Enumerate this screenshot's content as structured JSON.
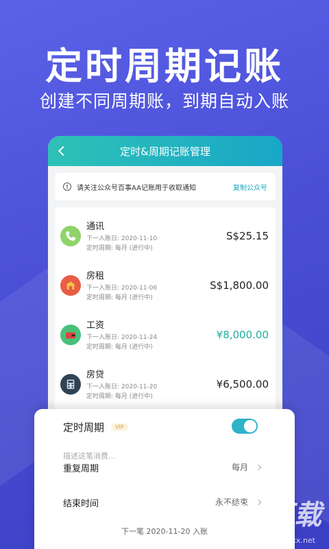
{
  "promo": {
    "headline": "定时周期记账",
    "subline": "创建不同周期账，到期自动入账"
  },
  "app": {
    "title": "定时&周期记账管理",
    "notice_text": "请关注公众号百事AA记账用于收取通知",
    "copy_label": "复制公众号"
  },
  "records": [
    {
      "name": "通讯",
      "next_date": "下一入账日: 2020-11-10",
      "cycle": "定时周期: 每月 (进行中)",
      "amount": "S$25.15",
      "icon": "phone-icon",
      "color": "#8fd36a"
    },
    {
      "name": "房租",
      "next_date": "下一入账日: 2020-11-06",
      "cycle": "定时周期: 每月 (进行中)",
      "amount": "S$1,800.00",
      "icon": "house-icon",
      "color": "#e95c45"
    },
    {
      "name": "工资",
      "next_date": "下一入账日: 2020-11-24",
      "cycle": "定时周期: 每月 (进行中)",
      "amount": "¥8,000.00",
      "icon": "wallet-icon",
      "color": "#49c07a",
      "income": true
    },
    {
      "name": "房贷",
      "next_date": "下一入账日: 2020-11-20",
      "cycle": "定时周期: 每月 (进行中)",
      "amount": "¥6,500.00",
      "icon": "calculator-icon",
      "color": "#2f4354"
    }
  ],
  "sheet": {
    "toggle_label": "定时周期",
    "vip_badge": "VIP",
    "description_placeholder": "描述这笔消费...",
    "repeat_label": "重复周期",
    "repeat_value": "每月",
    "end_label": "结束时间",
    "end_value": "永不结束",
    "next_entry": "下一笔 2020-11-20 入账"
  },
  "watermark": {
    "logo": "KK下载",
    "url": "www.kkx.net"
  },
  "colors": {
    "background": "#4a4fd6",
    "accent": "#1aa8c4",
    "income": "#1fae9a"
  }
}
